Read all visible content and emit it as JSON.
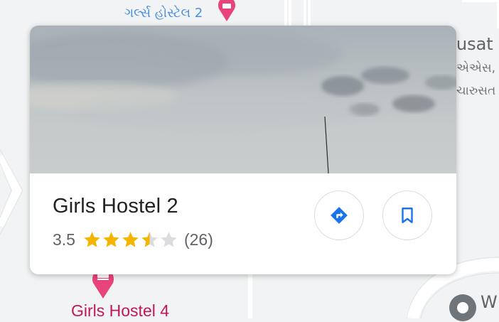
{
  "map": {
    "labels": {
      "top_place": "ગર્લ્સ હોસ્ટેલ 2",
      "right_1": "rusat",
      "right_2": "એએસ,",
      "right_3": "ચારુસત",
      "bottom_place": "Girls Hostel 4",
      "bottom_right": "W"
    },
    "pin_color": "#e8437a"
  },
  "card": {
    "title": "Girls Hostel 2",
    "rating": "3.5",
    "rating_value": 3.5,
    "rating_max": 5,
    "review_count": "(26)",
    "star_color": "#f4b400",
    "star_empty_color": "#dadce0",
    "accent": "#1a73e8"
  }
}
